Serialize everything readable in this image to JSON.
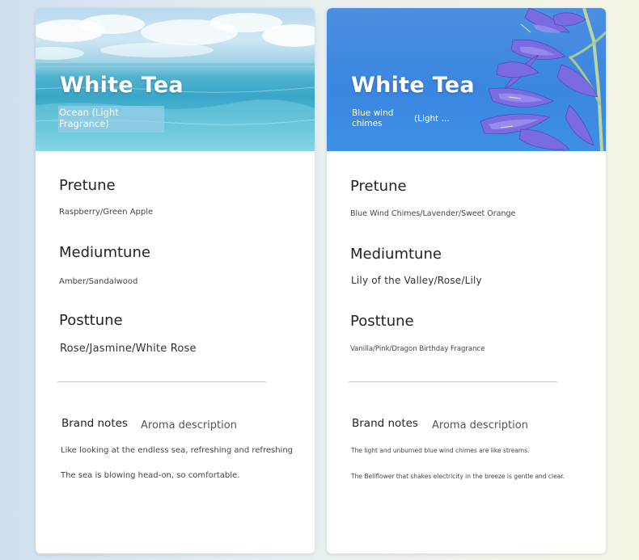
{
  "cards": [
    {
      "title": "White Tea",
      "subtitle": "Ocean (Light Fragrance)",
      "top_note_heading": "Pretune",
      "top_note_value": "Raspberry/Green Apple",
      "middle_note_heading": "Mediumtune",
      "middle_note_value": "Amber/Sandalwood",
      "base_note_heading": "Posttune",
      "base_note_value": "Rose/Jasmine/White Rose",
      "brand_notes_label": "Brand notes",
      "aroma_label": "Aroma description",
      "description_lines": [
        "Like looking at the endless sea, refreshing and refreshing",
        "The sea is blowing head-on, so comfortable."
      ]
    },
    {
      "title": "White Tea",
      "subtitle_part_a": "Blue wind chimes",
      "subtitle_part_b": "(Light ...",
      "top_note_heading": "Pretune",
      "top_note_value": "Blue Wind Chimes/Lavender/Sweet Orange",
      "middle_note_heading": "Mediumtune",
      "middle_note_value": "Lily of the Valley/Rose/Lily",
      "base_note_heading": "Posttune",
      "base_note_value": "Vanilla/Pink/Dragon Birthday Fragrance",
      "brand_notes_label": "Brand notes",
      "aroma_label": "Aroma description",
      "description_lines": [
        "The light and unburned blue wind chimes are like streams.",
        "The Bellflower that shakes electricity in the breeze is gentle and clear."
      ]
    }
  ],
  "colors": {
    "ocean_banner": "#3aa6c8",
    "blue_banner": "#3a86e0",
    "flower_purple": "#6b5bd6",
    "card_background": "#ffffff"
  },
  "icons": {
    "left_banner_image": "ocean-sky-image",
    "right_banner_image": "agapanthus-flower-image"
  }
}
